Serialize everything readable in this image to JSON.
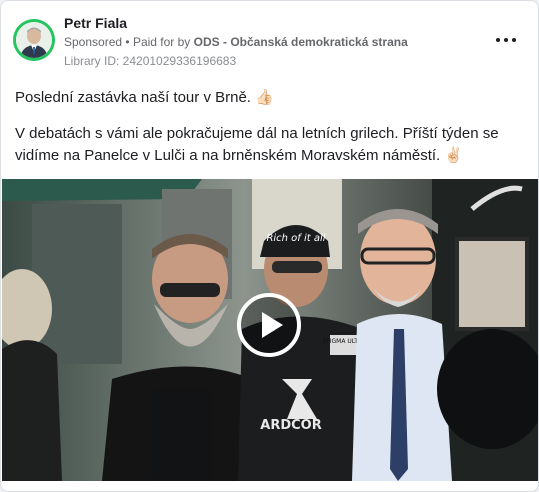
{
  "post": {
    "author": "Petr Fiala",
    "sponsored": "Sponsored",
    "paid_for_prefix": "Paid for by",
    "paid_for": "ODS - Občanská demokratická strana",
    "library_id": "Library ID: 24201029336196683",
    "text_line1": "Poslední zastávka naší tour v Brně. 👍🏻",
    "text_line2": "V debatách s vámi ale pokračujeme dál na letních grilech. Příští týden se vidíme na Panelce v Lulči a na brněnském Moravském náměstí. ✌🏻"
  },
  "media": {
    "cap_text": "Rich of it all",
    "patch_text": "STIGMA ULTRAS",
    "shirt_text": "ARDCOR"
  },
  "icons": {
    "more": "more-options-icon",
    "play": "play-icon"
  },
  "colors": {
    "avatar_ring": "#22c55e",
    "text_primary": "#1c1e21",
    "text_secondary": "#65676b"
  }
}
